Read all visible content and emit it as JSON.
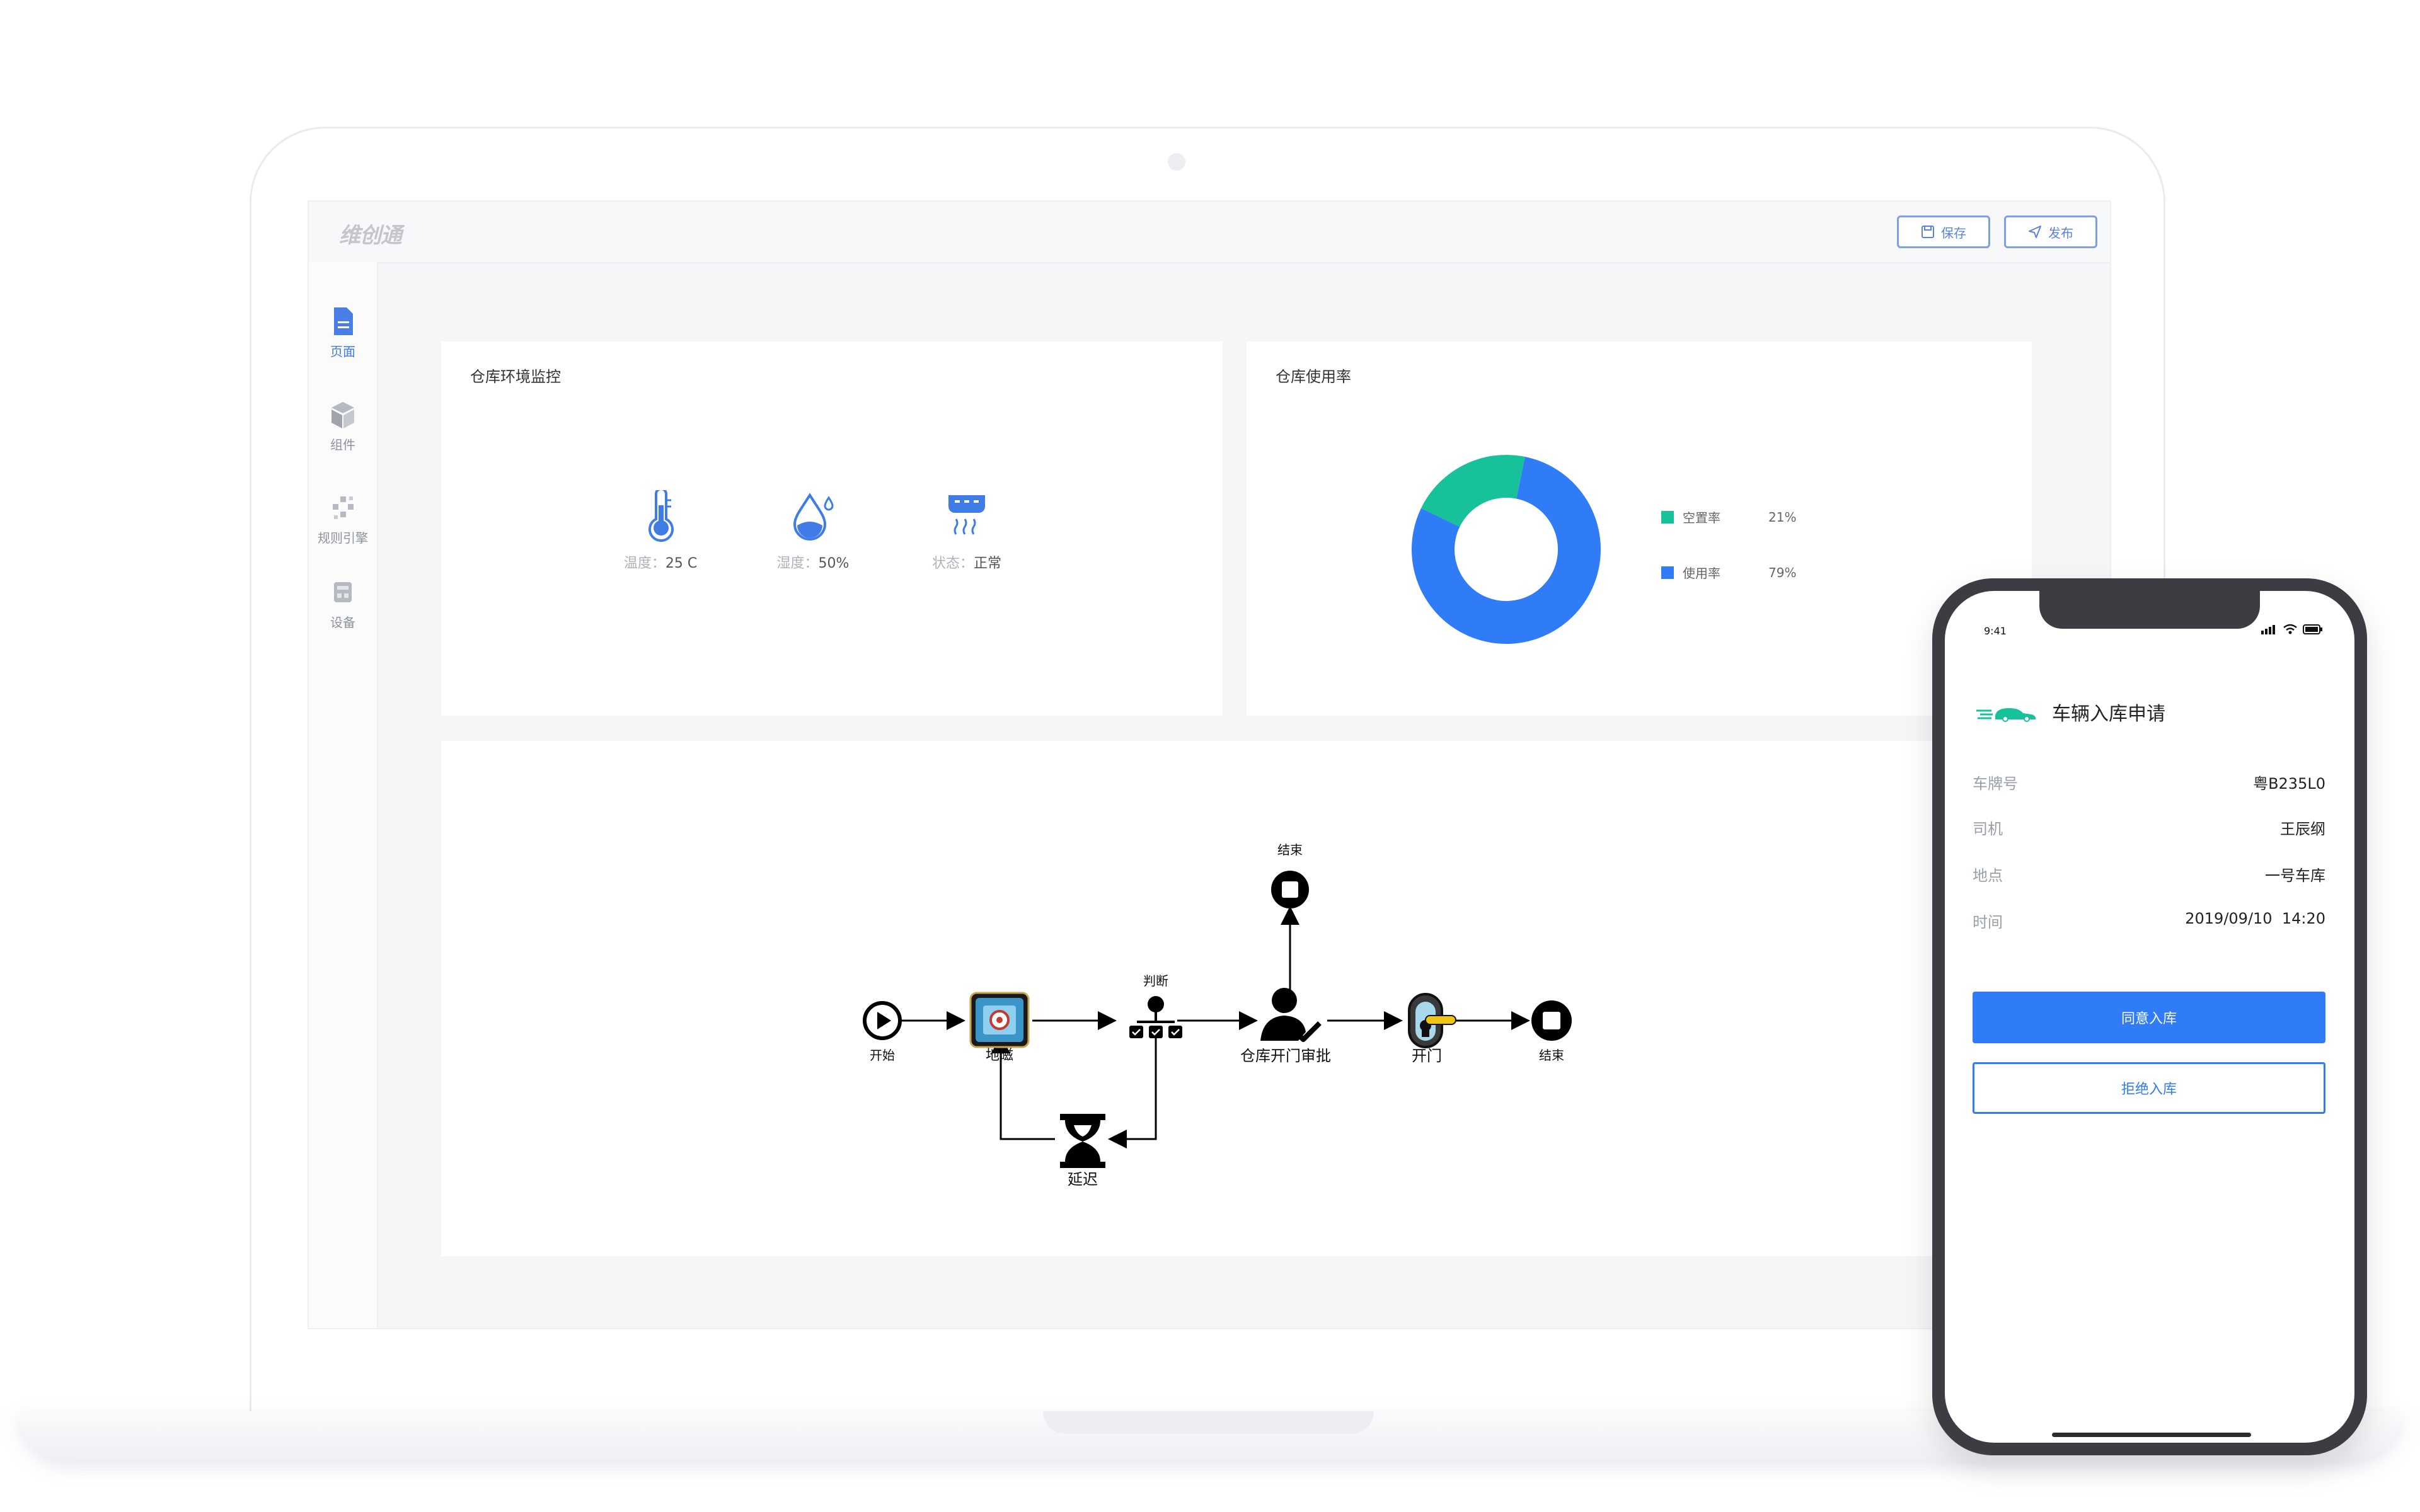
{
  "app": {
    "logo": "维创通",
    "toolbar": {
      "save_label": "保存",
      "publish_label": "发布"
    }
  },
  "sidebar": {
    "items": [
      {
        "label": "页面",
        "icon": "page-icon",
        "active": true
      },
      {
        "label": "组件",
        "icon": "cube-icon",
        "active": false
      },
      {
        "label": "规则引擎",
        "icon": "rule-engine-icon",
        "active": false
      },
      {
        "label": "设备",
        "icon": "device-icon",
        "active": false
      }
    ]
  },
  "env_card": {
    "title": "仓库环境监控",
    "items": [
      {
        "label": "温度：",
        "value": "25 C",
        "icon": "thermometer-icon"
      },
      {
        "label": "湿度：",
        "value": "50%",
        "icon": "water-drop-icon"
      },
      {
        "label": "状态：",
        "value": "正常",
        "icon": "sensor-icon"
      }
    ]
  },
  "usage_card": {
    "title": "仓库使用率",
    "chart_data": {
      "type": "pie",
      "donut": true,
      "categories": [
        "空置率",
        "使用率"
      ],
      "values": [
        21,
        79
      ],
      "value_labels": [
        "21%",
        "79%"
      ],
      "colors": [
        "#17c29a",
        "#2f7cf6"
      ],
      "legend": "right"
    }
  },
  "flow": {
    "nodes": {
      "start": "开始",
      "geomagnetic": "地磁",
      "judge": "判断",
      "approval": "仓库开门审批",
      "open_door": "开门",
      "end_right": "结束",
      "end_top": "结束",
      "delay": "延迟"
    }
  },
  "phone": {
    "time": "9:41",
    "title": "车辆入库申请",
    "fields": [
      {
        "key": "车牌号",
        "value": "粤B235L0"
      },
      {
        "key": "司机",
        "value": "王辰纲"
      },
      {
        "key": "地点",
        "value": "一号车库"
      },
      {
        "key": "时间",
        "value": "2019/09/10  14:20"
      }
    ],
    "approve_label": "同意入库",
    "reject_label": "拒绝入库"
  },
  "colors": {
    "accent": "#2f7cf6",
    "green": "#17c29a",
    "sidebar_active": "#3d7af0"
  }
}
